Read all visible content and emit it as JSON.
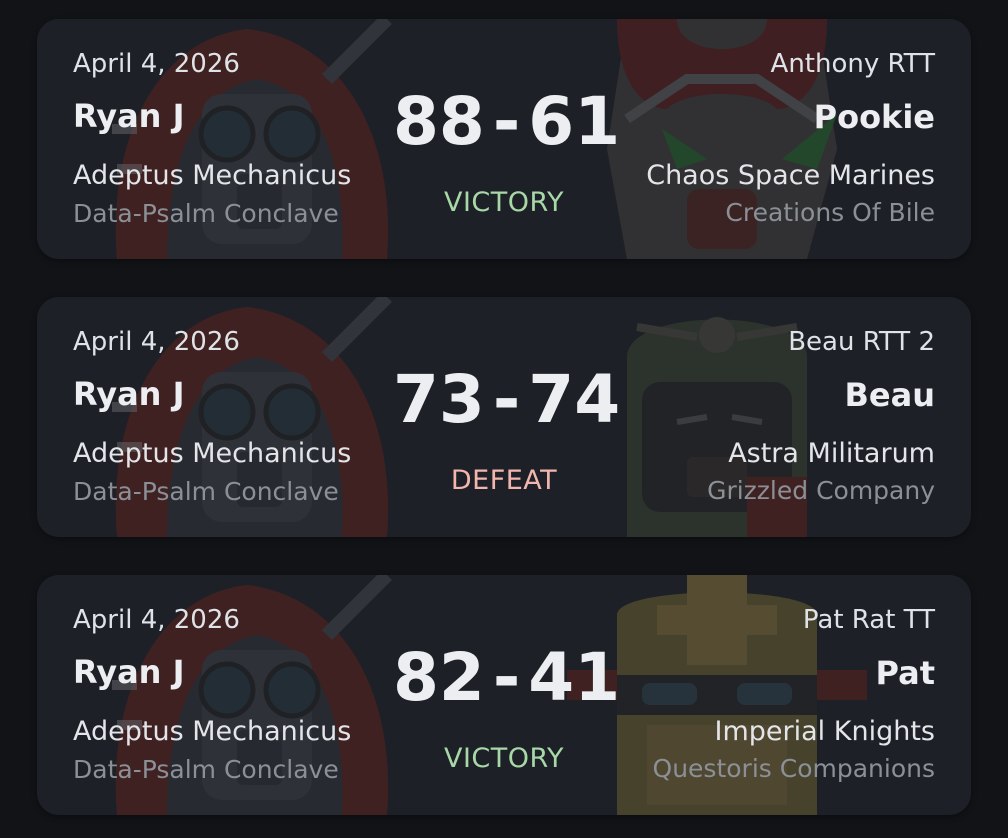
{
  "colors": {
    "victory": "#a8d8a8",
    "defeat": "#f2b6ae",
    "background": "#111317",
    "card": "#1e2126"
  },
  "matches": [
    {
      "date": "April 4, 2026",
      "event": "Anthony RTT",
      "player1": {
        "name": "Ryan J",
        "faction": "Adeptus Mechanicus",
        "subfaction": "Data-Psalm Conclave",
        "art_icon": "tech-priest-portrait-icon"
      },
      "player2": {
        "name": "Pookie",
        "faction": "Chaos Space Marines",
        "subfaction": "Creations Of Bile",
        "art_icon": "chaos-marine-helmet-icon"
      },
      "score1": "88",
      "separator": "-",
      "score2": "61",
      "result": "VICTORY"
    },
    {
      "date": "April 4, 2026",
      "event": "Beau RTT 2",
      "player1": {
        "name": "Ryan J",
        "faction": "Adeptus Mechanicus",
        "subfaction": "Data-Psalm Conclave",
        "art_icon": "tech-priest-portrait-icon"
      },
      "player2": {
        "name": "Beau",
        "faction": "Astra Militarum",
        "subfaction": "Grizzled Company",
        "art_icon": "guardsman-helmet-icon"
      },
      "score1": "73",
      "separator": "-",
      "score2": "74",
      "result": "DEFEAT"
    },
    {
      "date": "April 4, 2026",
      "event": "Pat Rat TT",
      "player1": {
        "name": "Ryan J",
        "faction": "Adeptus Mechanicus",
        "subfaction": "Data-Psalm Conclave",
        "art_icon": "tech-priest-portrait-icon"
      },
      "player2": {
        "name": "Pat",
        "faction": "Imperial Knights",
        "subfaction": "Questoris Companions",
        "art_icon": "knight-helm-icon"
      },
      "score1": "82",
      "separator": "-",
      "score2": "41",
      "result": "VICTORY"
    }
  ]
}
